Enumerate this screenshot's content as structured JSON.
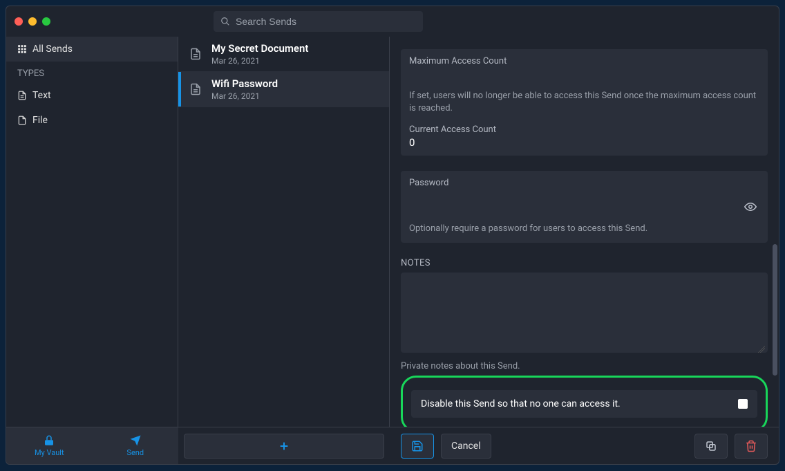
{
  "search": {
    "placeholder": "Search Sends"
  },
  "sidebar": {
    "allSends": "All Sends",
    "typesHeader": "TYPES",
    "text": "Text",
    "file": "File"
  },
  "list": [
    {
      "title": "My Secret Document",
      "date": "Mar 26, 2021"
    },
    {
      "title": "Wifi Password",
      "date": "Mar 26, 2021"
    }
  ],
  "detail": {
    "maxAccessLabel": "Maximum Access Count",
    "maxAccessHelp": "If set, users will no longer be able to access this Send once the maximum access count is reached.",
    "currentAccessLabel": "Current Access Count",
    "currentAccessValue": "0",
    "passwordLabel": "Password",
    "passwordHelp": "Optionally require a password for users to access this Send.",
    "notesLabel": "NOTES",
    "notesHelp": "Private notes about this Send.",
    "disableLabel": "Disable this Send so that no one can access it."
  },
  "footer": {
    "vault": "My Vault",
    "send": "Send",
    "cancel": "Cancel"
  }
}
